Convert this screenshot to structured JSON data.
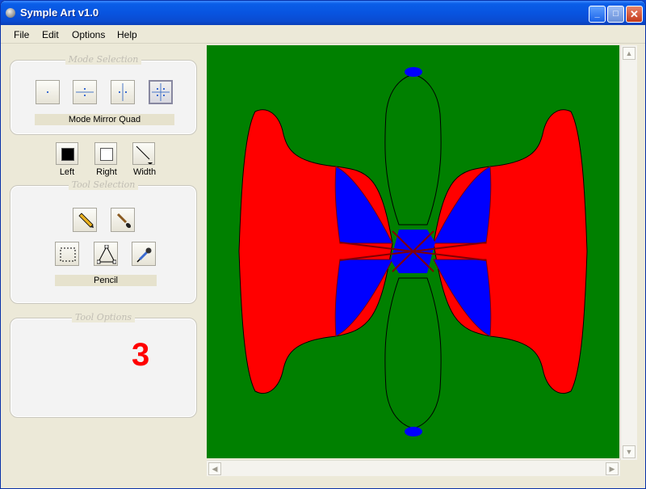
{
  "window": {
    "title": "Symple Art v1.0",
    "minimize": "_",
    "maximize": "□",
    "close": "✕"
  },
  "menu": [
    "File",
    "Edit",
    "Options",
    "Help"
  ],
  "mode_selection": {
    "title": "Mode Selection",
    "current_label": "Mode Mirror Quad",
    "buttons": [
      "mode-single",
      "mode-mirror-horizontal",
      "mode-mirror-vertical",
      "mode-mirror-quad"
    ],
    "active": "mode-mirror-quad"
  },
  "colors": {
    "left_label": "Left",
    "right_label": "Right",
    "width_label": "Width",
    "left_color": "#000000",
    "right_color": "#ffffff"
  },
  "tool_selection": {
    "title": "Tool Selection",
    "tools": [
      "pencil-icon",
      "brush-icon",
      "rect-select-icon",
      "triangle-icon",
      "eyedropper-icon"
    ],
    "current_label": "Pencil"
  },
  "tool_options": {
    "title": "Tool Options",
    "value": "3"
  },
  "canvas": {
    "background": "#008000",
    "shape_colors": [
      "#ff0000",
      "#0000ff",
      "#800000",
      "#008000"
    ]
  },
  "scroll_arrows": {
    "up": "▲",
    "down": "▼",
    "left": "◀",
    "right": "▶"
  }
}
